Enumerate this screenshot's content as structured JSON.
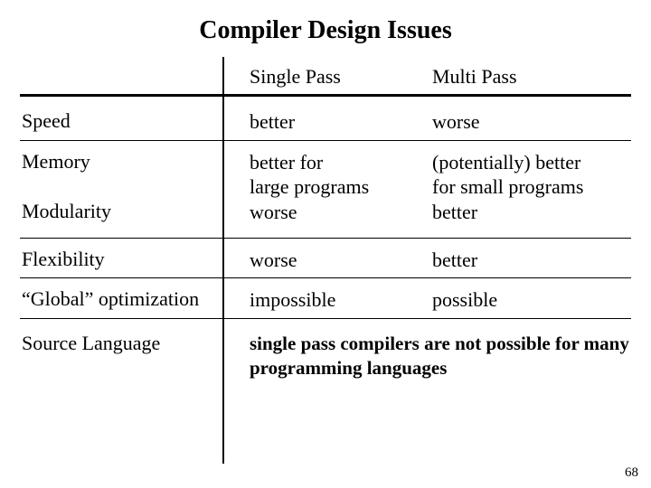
{
  "title": "Compiler Design Issues",
  "columns": {
    "single": "Single Pass",
    "multi": "Multi Pass"
  },
  "rows": {
    "speed": {
      "label": "Speed",
      "single": "better",
      "multi": "worse"
    },
    "memory": {
      "label": "Memory",
      "single": "better for\nlarge programs",
      "multi": "(potentially) better\nfor small programs"
    },
    "modularity": {
      "label": "Modularity",
      "single": "worse",
      "multi": "better"
    },
    "flexibility": {
      "label": "Flexibility",
      "single": "worse",
      "multi": "better"
    },
    "global_opt": {
      "label": "“Global” optimization",
      "single": "impossible",
      "multi": "possible"
    },
    "source_lang": {
      "label": "Source Language",
      "note": "single pass compilers are not possible for many programming languages"
    }
  },
  "page_number": "68",
  "chart_data": {
    "type": "table",
    "title": "Compiler Design Issues",
    "columns": [
      "",
      "Single Pass",
      "Multi Pass"
    ],
    "rows": [
      [
        "Speed",
        "better",
        "worse"
      ],
      [
        "Memory",
        "better for large programs",
        "(potentially) better for small programs"
      ],
      [
        "Modularity",
        "worse",
        "better"
      ],
      [
        "Flexibility",
        "worse",
        "better"
      ],
      [
        "\"Global\" optimization",
        "impossible",
        "possible"
      ],
      [
        "Source Language",
        "single pass compilers are not possible for many programming languages",
        ""
      ]
    ]
  }
}
